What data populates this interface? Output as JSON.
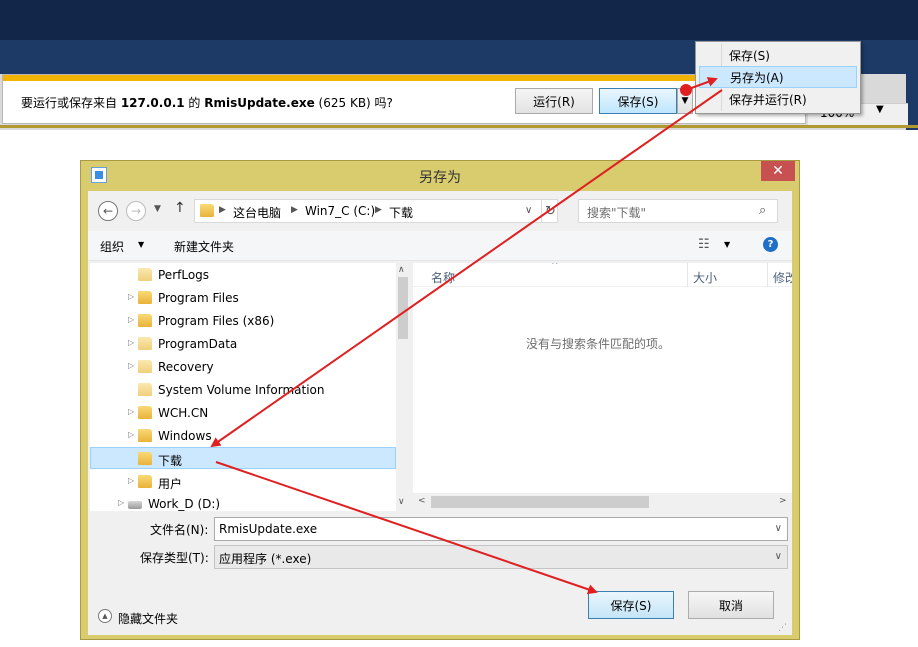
{
  "ie": {
    "zoom_label": "100%",
    "notification": {
      "text_prefix": "要运行或保存来自 ",
      "host": "127.0.0.1",
      "text_mid": " 的 ",
      "filename": "RmisUpdate.exe",
      "text_suffix": " (625 KB) 吗?",
      "run_label": "运行(R)",
      "save_label": "保存(S)"
    },
    "save_menu": {
      "items": [
        {
          "label": "保存(S)"
        },
        {
          "label": "另存为(A)"
        },
        {
          "label": "保存并运行(R)"
        }
      ]
    }
  },
  "dialog": {
    "title": "另存为",
    "close_label": "✕",
    "breadcrumbs": [
      "这台电脑",
      "Win7_C (C:)",
      "下载"
    ],
    "search_placeholder": "搜索\"下载\"",
    "toolbar": {
      "organize_label": "组织",
      "new_folder_label": "新建文件夹",
      "help_label": "?"
    },
    "tree": [
      {
        "label": "PerfLogs",
        "expandable": false,
        "icon": "folder-icon"
      },
      {
        "label": "Program Files",
        "expandable": true,
        "icon": "folder-icon"
      },
      {
        "label": "Program Files (x86)",
        "expandable": true,
        "icon": "folder-icon"
      },
      {
        "label": "ProgramData",
        "expandable": true,
        "icon": "folder-icon"
      },
      {
        "label": "Recovery",
        "expandable": true,
        "icon": "folder-icon"
      },
      {
        "label": "System Volume Information",
        "expandable": false,
        "icon": "folder-icon"
      },
      {
        "label": "WCH.CN",
        "expandable": true,
        "icon": "folder-icon"
      },
      {
        "label": "Windows",
        "expandable": true,
        "icon": "folder-icon"
      },
      {
        "label": "下载",
        "expandable": false,
        "icon": "folder-icon",
        "selected": true
      },
      {
        "label": "用户",
        "expandable": true,
        "icon": "folder-icon"
      },
      {
        "label": "Work_D (D:)",
        "expandable": true,
        "icon": "drive-icon"
      }
    ],
    "columns": {
      "name": "名称",
      "size": "大小",
      "modified": "修改"
    },
    "empty_message": "没有与搜索条件匹配的项。",
    "filename_label": "文件名(N):",
    "filename_value": "RmisUpdate.exe",
    "filetype_label": "保存类型(T):",
    "filetype_value": "应用程序 (*.exe)",
    "hide_folders_label": "隐藏文件夹",
    "save_label": "保存(S)",
    "cancel_label": "取消"
  },
  "colors": {
    "annotation_arrow": "#e02020",
    "notification_stripe": "#f3b400",
    "dialog_frame": "#d8cc6e",
    "selection": "#cce8ff",
    "close_button": "#c75050"
  }
}
